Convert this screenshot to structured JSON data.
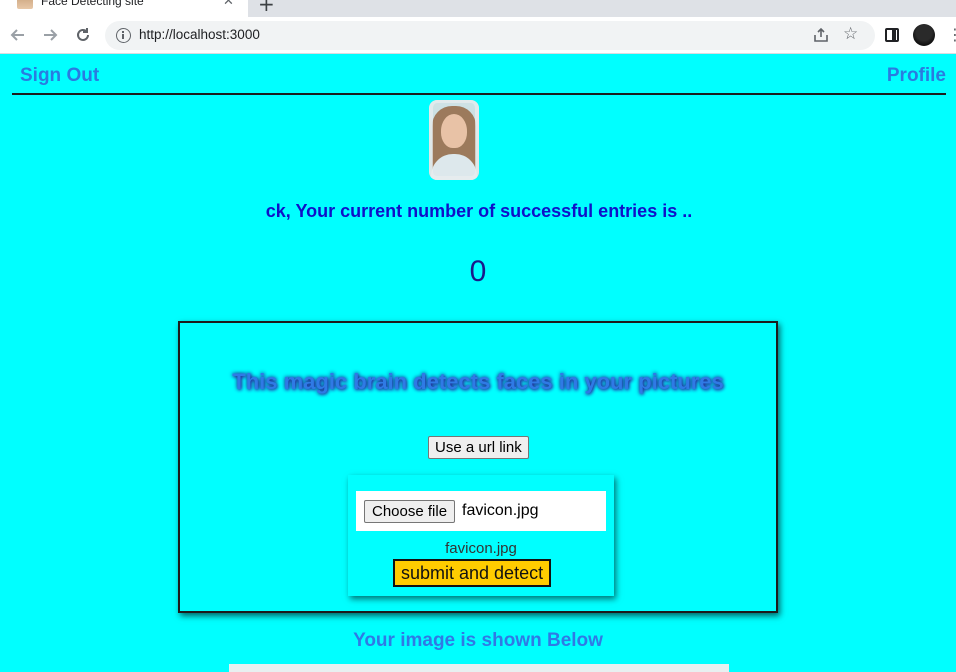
{
  "browser": {
    "tab_title": "Face Detecting site",
    "tab_close": "✕",
    "new_tab": "+",
    "url": "http://localhost:3000",
    "back_icon": "arrow-left-icon",
    "forward_icon": "arrow-right-icon",
    "reload_icon": "reload-icon",
    "star_icon": "☆",
    "menu_icon": "⋮"
  },
  "nav": {
    "sign_out": "Sign Out",
    "profile": "Profile"
  },
  "user": {
    "entries_message": "ck, Your current number of successful entries is ..",
    "entries_count": "0"
  },
  "card": {
    "title": "This magic brain detects faces in your pictures",
    "url_button": "Use a url link",
    "choose_file_button": "Choose file",
    "selected_file": "favicon.jpg",
    "file_caption": "favicon.jpg",
    "submit_button": "submit and detect"
  },
  "result": {
    "heading": "Your image is shown Below"
  },
  "colors": {
    "page_background": "#00ffff",
    "link_blue": "#2a7be0",
    "entries_text": "#1010c8",
    "submit_yellow": "#ffcc00"
  }
}
